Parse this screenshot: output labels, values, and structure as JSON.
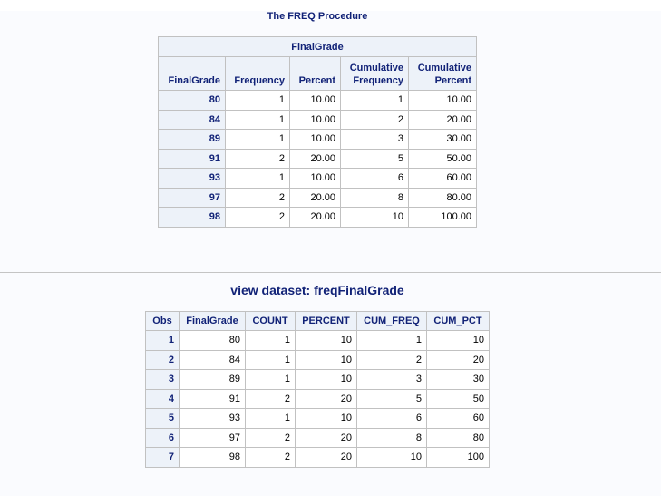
{
  "freq_procedure": {
    "title": "The FREQ Procedure",
    "table_caption": "FinalGrade",
    "columns": [
      "FinalGrade",
      "Frequency",
      "Percent",
      "Cumulative\nFrequency",
      "Cumulative\nPercent"
    ],
    "column_lines": [
      [
        "FinalGrade"
      ],
      [
        "Frequency"
      ],
      [
        "Percent"
      ],
      [
        "Cumulative",
        "Frequency"
      ],
      [
        "Cumulative",
        "Percent"
      ]
    ],
    "rows": [
      [
        "80",
        "1",
        "10.00",
        "1",
        "10.00"
      ],
      [
        "84",
        "1",
        "10.00",
        "2",
        "20.00"
      ],
      [
        "89",
        "1",
        "10.00",
        "3",
        "30.00"
      ],
      [
        "91",
        "2",
        "20.00",
        "5",
        "50.00"
      ],
      [
        "93",
        "1",
        "10.00",
        "6",
        "60.00"
      ],
      [
        "97",
        "2",
        "20.00",
        "8",
        "80.00"
      ],
      [
        "98",
        "2",
        "20.00",
        "10",
        "100.00"
      ]
    ]
  },
  "dataset_view": {
    "title": "view dataset: freqFinalGrade",
    "columns": [
      "Obs",
      "FinalGrade",
      "COUNT",
      "PERCENT",
      "CUM_FREQ",
      "CUM_PCT"
    ],
    "rows": [
      [
        "1",
        "80",
        "1",
        "10",
        "1",
        "10"
      ],
      [
        "2",
        "84",
        "1",
        "10",
        "2",
        "20"
      ],
      [
        "3",
        "89",
        "1",
        "10",
        "3",
        "30"
      ],
      [
        "4",
        "91",
        "2",
        "20",
        "5",
        "50"
      ],
      [
        "5",
        "93",
        "1",
        "10",
        "6",
        "60"
      ],
      [
        "6",
        "97",
        "2",
        "20",
        "8",
        "80"
      ],
      [
        "7",
        "98",
        "2",
        "20",
        "10",
        "100"
      ]
    ]
  },
  "colors": {
    "header_text": "#112277",
    "header_bg": "#edf2f9",
    "border": "#c1c1c1",
    "page_bg": "#fafbfe"
  }
}
